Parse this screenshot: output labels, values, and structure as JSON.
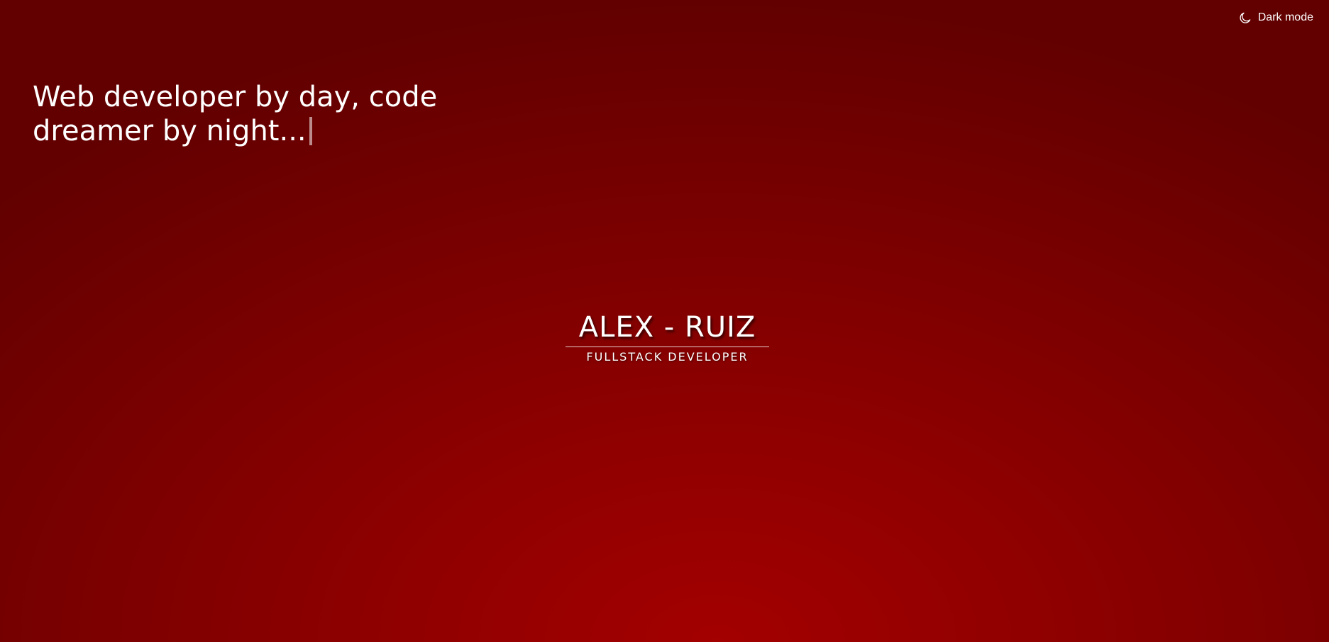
{
  "header": {
    "theme_toggle": {
      "label": "Dark mode",
      "icon": "moon-icon"
    }
  },
  "hero": {
    "tagline_line1": "Web developer by day, code",
    "tagline_line2": "dreamer by night..."
  },
  "logo": {
    "name": "ALEX - RUIZ",
    "subtitle": "FULLSTACK DEVELOPER"
  },
  "colors": {
    "background_center": "#a30000",
    "background_edge": "#620000",
    "text": "#ffffff"
  }
}
